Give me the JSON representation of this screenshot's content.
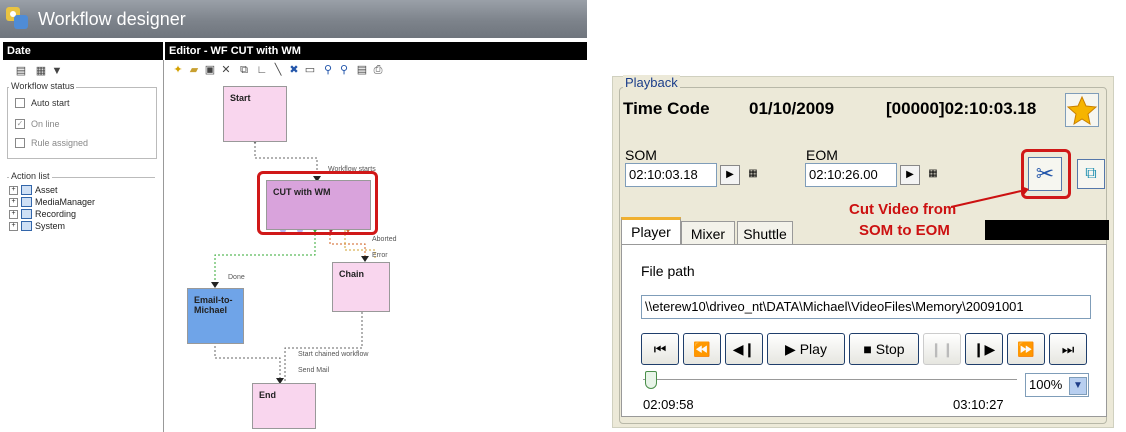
{
  "designer": {
    "title": "Workflow designer",
    "left_panel_title": "Date",
    "editor_title": "Editor - WF CUT with WM",
    "workflow_status": {
      "legend": "Workflow status",
      "auto_start": "Auto start",
      "on_line": "On line",
      "rule_assigned": "Rule assigned"
    },
    "action_list": {
      "legend": "Action list",
      "items": [
        "Asset",
        "MediaManager",
        "Recording",
        "System"
      ]
    },
    "nodes": {
      "start": "Start",
      "cut": "CUT with WM",
      "email": "Email-to-\nMichael",
      "chain": "Chain",
      "end": "End"
    },
    "edges": {
      "workflow_starts": "Workflow starts",
      "aborted": "Aborted",
      "error": "Error",
      "done": "Done",
      "start_chained": "Start chained workflow",
      "send_mail": "Send Mail"
    }
  },
  "playback": {
    "legend": "Playback",
    "time_code_label": "Time Code",
    "date": "01/10/2009",
    "timecode": "[00000]02:10:03.18",
    "som_label": "SOM",
    "eom_label": "EOM",
    "som_value": "02:10:03.18",
    "eom_value": "02:10:26.00",
    "annotation_line1": "Cut Video from",
    "annotation_line2": "SOM to EOM",
    "tabs": [
      "Player",
      "Mixer",
      "Shuttle"
    ],
    "file_path_label": "File path",
    "file_path": "\\\\eterew10\\driveo_nt\\DATA\\Michael\\VideoFiles\\Memory\\20091001",
    "play_label": "Play",
    "stop_label": "Stop",
    "zoom": "100%",
    "time_start": "02:09:58",
    "time_end": "03:10:27",
    "colors": {
      "annotation": "#cc1111",
      "highlight": "#d01818",
      "cut_node": "#d9a3dc",
      "email_node": "#6fa4e8",
      "pink_node": "#f9d6ee"
    }
  }
}
